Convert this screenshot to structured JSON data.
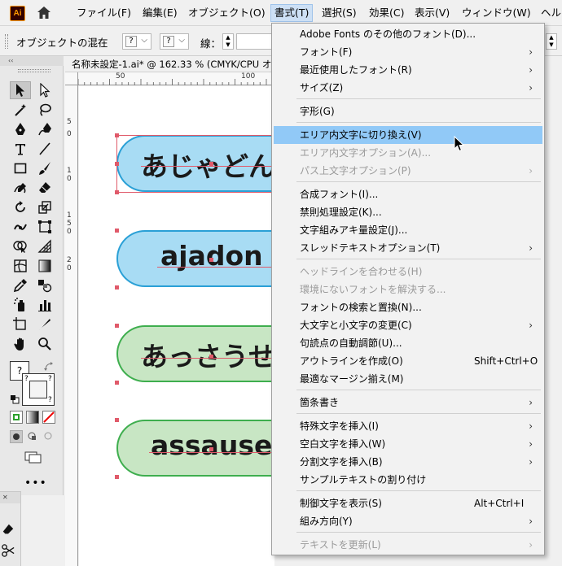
{
  "app": {
    "logo_text": "Ai",
    "menus": [
      "ファイル(F)",
      "編集(E)",
      "オブジェクト(O)",
      "書式(T)",
      "選択(S)",
      "効果(C)",
      "表示(V)",
      "ウィンドウ(W)",
      "ヘル"
    ],
    "active_menu": "書式(T)"
  },
  "controlbar": {
    "no_selection": "オブジェクトの混在",
    "q1": "?",
    "q2": "?",
    "stroke_label": "線："
  },
  "toolpanel": {
    "collapse": "‹‹",
    "more": "•••"
  },
  "panel2": {
    "close": "✕"
  },
  "document": {
    "tab_title": "名称未設定-1.ai* @ 162.33 % (CMYK/CPU オー",
    "ruler_h": [
      "50",
      "100"
    ],
    "ruler_v": [
      "5",
      "0",
      "1",
      "0",
      "1",
      "5",
      "0",
      "2",
      "0"
    ],
    "pills": [
      {
        "text": "あじゃどん",
        "style": "blue"
      },
      {
        "text": "ajadon",
        "style": "blue"
      },
      {
        "text": "あっさうせ",
        "style": "green"
      },
      {
        "text": "assause",
        "style": "green"
      }
    ]
  },
  "dropdown": {
    "items": [
      {
        "label": "Adobe Fonts のその他のフォント(D)...",
        "state": "normal",
        "arrow": "",
        "shortcut": ""
      },
      {
        "label": "フォント(F)",
        "state": "normal",
        "arrow": "›",
        "shortcut": ""
      },
      {
        "label": "最近使用したフォント(R)",
        "state": "normal",
        "arrow": "›",
        "shortcut": ""
      },
      {
        "label": "サイズ(Z)",
        "state": "normal",
        "arrow": "›",
        "shortcut": ""
      },
      {
        "label": "字形(G)",
        "state": "normal",
        "arrow": "",
        "shortcut": ""
      },
      {
        "label": "エリア内文字に切り換え(V)",
        "state": "highlight",
        "arrow": "",
        "shortcut": ""
      },
      {
        "label": "エリア内文字オプション(A)...",
        "state": "disabled",
        "arrow": "",
        "shortcut": ""
      },
      {
        "label": "パス上文字オプション(P)",
        "state": "disabled",
        "arrow": "›",
        "shortcut": ""
      },
      {
        "label": "合成フォント(I)...",
        "state": "normal",
        "arrow": "",
        "shortcut": ""
      },
      {
        "label": "禁則処理設定(K)...",
        "state": "normal",
        "arrow": "",
        "shortcut": ""
      },
      {
        "label": "文字組みアキ量設定(J)...",
        "state": "normal",
        "arrow": "",
        "shortcut": ""
      },
      {
        "label": "スレッドテキストオプション(T)",
        "state": "normal",
        "arrow": "›",
        "shortcut": ""
      },
      {
        "label": "ヘッドラインを合わせる(H)",
        "state": "disabled",
        "arrow": "",
        "shortcut": ""
      },
      {
        "label": "環境にないフォントを解決する...",
        "state": "disabled",
        "arrow": "",
        "shortcut": ""
      },
      {
        "label": "フォントの検索と置換(N)...",
        "state": "normal",
        "arrow": "",
        "shortcut": ""
      },
      {
        "label": "大文字と小文字の変更(C)",
        "state": "normal",
        "arrow": "›",
        "shortcut": ""
      },
      {
        "label": "句読点の自動調節(U)...",
        "state": "normal",
        "arrow": "",
        "shortcut": ""
      },
      {
        "label": "アウトラインを作成(O)",
        "state": "normal",
        "arrow": "",
        "shortcut": "Shift+Ctrl+O"
      },
      {
        "label": "最適なマージン揃え(M)",
        "state": "normal",
        "arrow": "",
        "shortcut": ""
      },
      {
        "label": "箇条書き",
        "state": "normal",
        "arrow": "›",
        "shortcut": ""
      },
      {
        "label": "特殊文字を挿入(I)",
        "state": "normal",
        "arrow": "›",
        "shortcut": ""
      },
      {
        "label": "空白文字を挿入(W)",
        "state": "normal",
        "arrow": "›",
        "shortcut": ""
      },
      {
        "label": "分割文字を挿入(B)",
        "state": "normal",
        "arrow": "›",
        "shortcut": ""
      },
      {
        "label": "サンプルテキストの割り付け",
        "state": "normal",
        "arrow": "",
        "shortcut": ""
      },
      {
        "label": "制御文字を表示(S)",
        "state": "normal",
        "arrow": "",
        "shortcut": "Alt+Ctrl+I"
      },
      {
        "label": "組み方向(Y)",
        "state": "normal",
        "arrow": "›",
        "shortcut": ""
      },
      {
        "label": "テキストを更新(L)",
        "state": "disabled",
        "arrow": "›",
        "shortcut": ""
      }
    ]
  }
}
